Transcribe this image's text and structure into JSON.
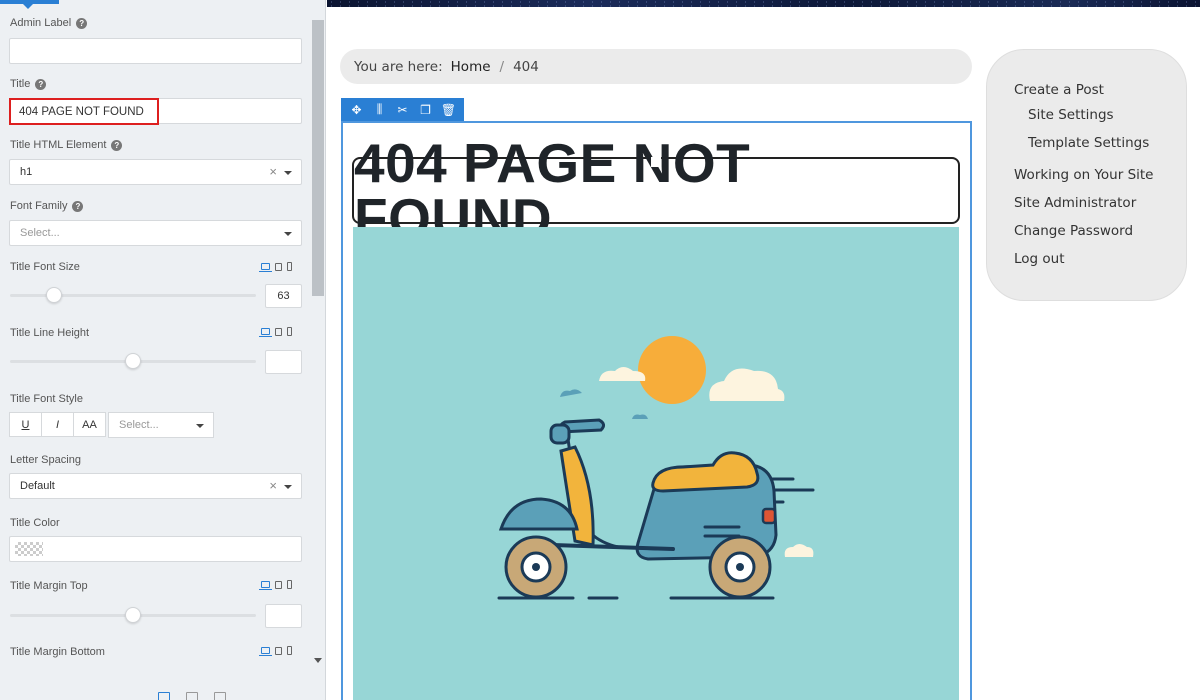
{
  "editor": {
    "fields": {
      "admin_label": "Admin Label",
      "title": "Title",
      "title_value": "404 PAGE NOT FOUND",
      "title_html_element": "Title HTML Element",
      "title_html_element_value": "h1",
      "font_family": "Font Family",
      "font_family_placeholder": "Select...",
      "title_font_size": "Title Font Size",
      "title_font_size_value": "63",
      "title_line_height": "Title Line Height",
      "title_font_style": "Title Font Style",
      "style_underline": "U",
      "style_italic": "I",
      "style_uppercase": "AA",
      "style_select_placeholder": "Select...",
      "letter_spacing": "Letter Spacing",
      "letter_spacing_value": "Default",
      "title_color": "Title Color",
      "title_margin_top": "Title Margin Top",
      "title_margin_bottom": "Title Margin Bottom"
    },
    "help_glyph": "?",
    "clear_glyph": "×",
    "slider_levels": {
      "title_font_size": 0.18,
      "title_line_height": 0.5,
      "title_margin_top": 0.5
    }
  },
  "breadcrumb": {
    "prefix": "You are here:",
    "home": "Home",
    "separator": "/",
    "current": "404"
  },
  "module_toolbar": {
    "icons": [
      "move-icon",
      "columns-icon",
      "settings-icon",
      "duplicate-icon",
      "delete-icon"
    ],
    "glyphs": [
      "✥",
      "⫼",
      "✂",
      "❐",
      "🗑"
    ]
  },
  "content": {
    "heading": "404 PAGE NOT FOUND"
  },
  "side_menu": {
    "create_post": "Create a Post",
    "site_settings": "Site Settings",
    "template_settings": "Template Settings",
    "working_on_site": "Working on Your Site",
    "site_administrator": "Site Administrator",
    "change_password": "Change Password",
    "log_out": "Log out"
  },
  "colors": {
    "accent": "#2a7fd4",
    "highlight_border": "#dd1f1f",
    "illustration_bg": "#97d6d6",
    "scooter_teal": "#5ba0b8",
    "scooter_mustard": "#f2b43c",
    "sun": "#f7ad3a"
  }
}
